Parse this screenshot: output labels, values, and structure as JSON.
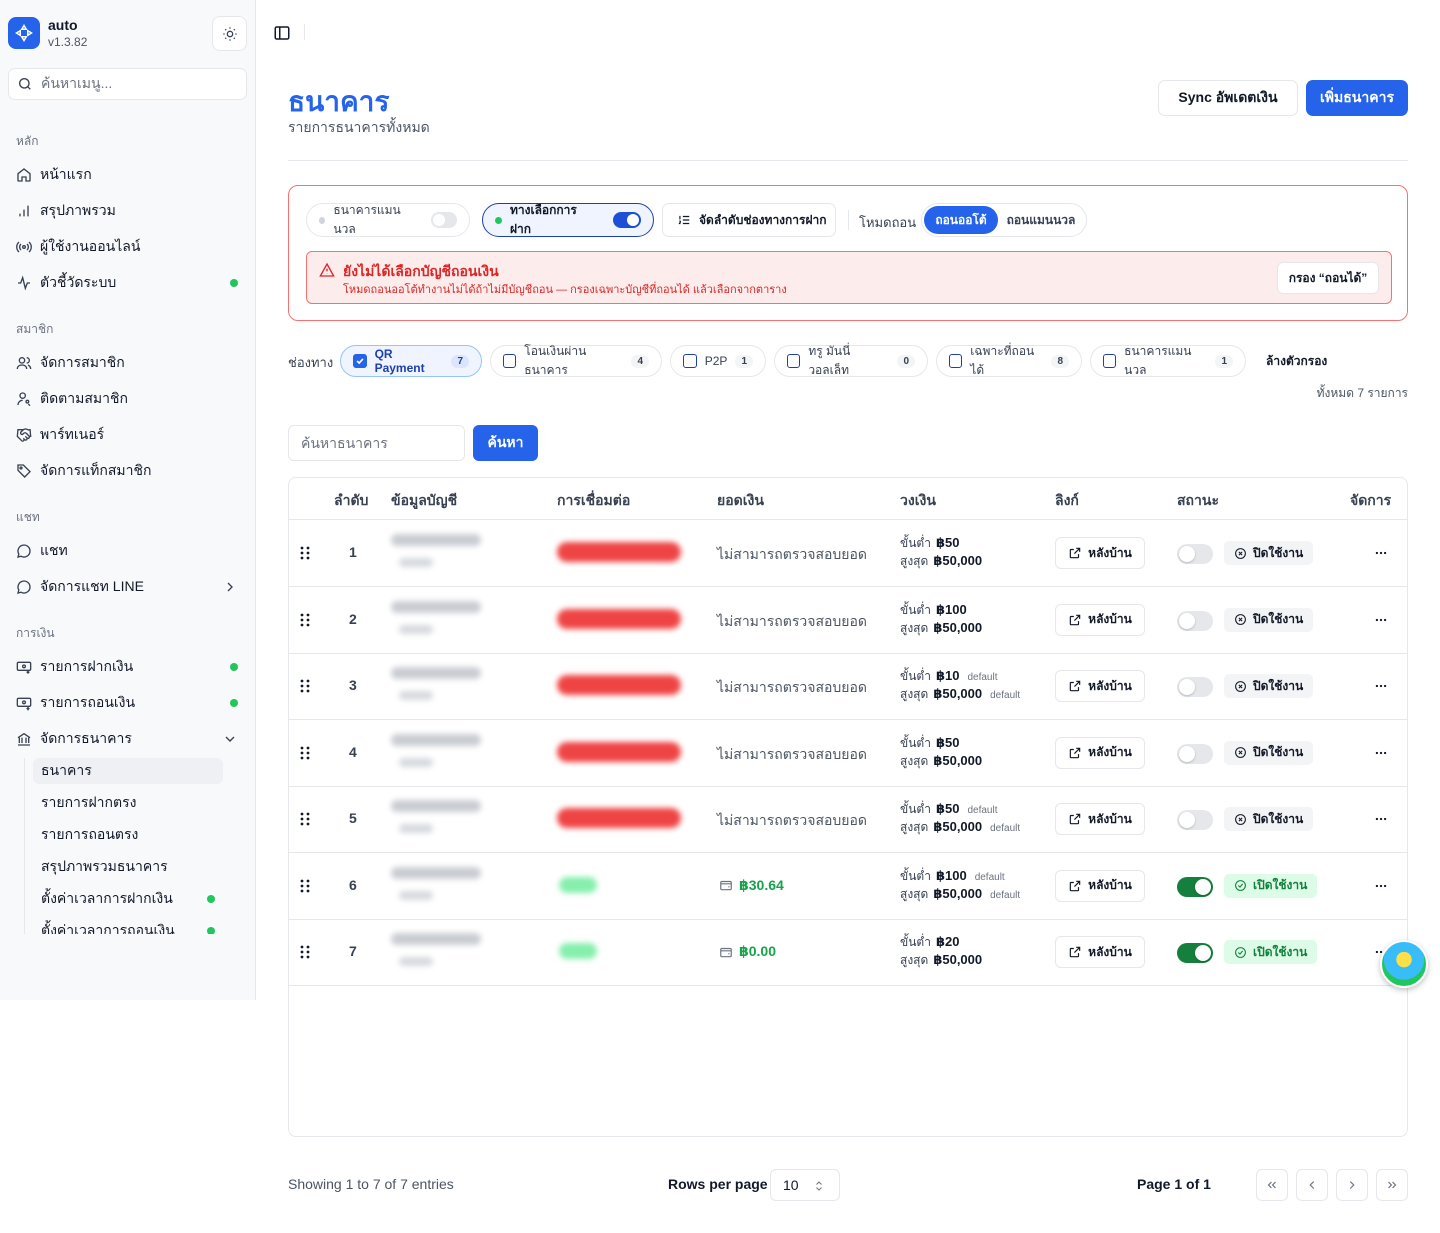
{
  "app": {
    "name": "auto",
    "version": "v1.3.82"
  },
  "sidebar": {
    "search_placeholder": "ค้นหาเมนู...",
    "groups": {
      "main": "หลัก",
      "members": "สมาชิก",
      "chat": "แชท",
      "finance": "การเงิน"
    },
    "items": {
      "home": "หน้าแรก",
      "summary": "สรุปภาพรวม",
      "online_users": "ผู้ใช้งานออนไลน์",
      "system_metrics": "ตัวชี้วัดระบบ",
      "manage_members": "จัดการสมาชิก",
      "track_members": "ติดตามสมาชิก",
      "partners": "พาร์ทเนอร์",
      "member_tags": "จัดการแท็กสมาชิก",
      "chat": "แชท",
      "line_chat": "จัดการแชท LINE",
      "deposits": "รายการฝากเงิน",
      "withdrawals": "รายการถอนเงิน",
      "manage_banks": "จัดการธนาคาร"
    },
    "sub_items": {
      "banks": "ธนาคาร",
      "direct_deposits": "รายการฝากตรง",
      "direct_withdrawals": "รายการถอนตรง",
      "bank_summary": "สรุปภาพรวมธนาคาร",
      "deposit_time": "ตั้งค่าเวลาการฝากเงิน",
      "withdraw_time": "ตั้งค่าเวลาการถอนเงิน"
    }
  },
  "header": {
    "title": "ธนาคาร",
    "subtitle": "รายการธนาคารทั้งหมด",
    "sync_button": "Sync อัพเดตเงิน",
    "add_button": "เพิ่มธนาคาร"
  },
  "deposit_panel": {
    "manual_bank_toggle": "ธนาคารแมนนวล",
    "deposit_channel_toggle": "ทางเลือกการฝาก",
    "order_button": "จัดลำดับช่องทางการฝาก",
    "mode_label": "โหมดถอน",
    "mode_auto": "ถอนออโต้",
    "mode_manual": "ถอนแมนนวล",
    "alert_title": "ยังไม่ได้เลือกบัญชีถอนเงิน",
    "alert_desc": "โหมดถอนออโต้ทำงานไม่ได้ถ้าไม่มีบัญชีถอน — กรองเฉพาะบัญชีที่ถอนได้ แล้วเลือกจากตาราง",
    "alert_button": "กรอง “ถอนได้”"
  },
  "filters": {
    "label": "ช่องทาง",
    "chips": [
      {
        "label": "QR Payment",
        "count": "7"
      },
      {
        "label": "โอนเงินผ่านธนาคาร",
        "count": "4"
      },
      {
        "label": "P2P",
        "count": "1"
      },
      {
        "label": "ทรู มันนี่ วอลเล็ท",
        "count": "0"
      },
      {
        "label": "เฉพาะที่ถอนได้",
        "count": "8"
      },
      {
        "label": "ธนาคารแมนนวล",
        "count": "1"
      }
    ],
    "clear": "ล้างตัวกรอง",
    "total": "ทั้งหมด 7 รายการ"
  },
  "search": {
    "placeholder": "ค้นหาธนาคาร",
    "button": "ค้นหา"
  },
  "table": {
    "columns": {
      "index": "ลำดับ",
      "account": "ข้อมูลบัญชี",
      "connection": "การเชื่อมต่อ",
      "balance": "ยอดเงิน",
      "limit": "วงเงิน",
      "link": "ลิงก์",
      "status": "สถานะ",
      "actions": "จัดการ"
    },
    "labels": {
      "min": "ขั้นต่ำ",
      "max": "สูงสุด",
      "default": "default",
      "link_button": "หลังบ้าน"
    },
    "rows": [
      {
        "index": "1",
        "balance": "ไม่สามารถตรวจสอบยอด",
        "min": "฿50",
        "max": "฿50,000",
        "min_default": false,
        "max_default": false,
        "status": "ปิดใช้งาน",
        "enabled": false
      },
      {
        "index": "2",
        "balance": "ไม่สามารถตรวจสอบยอด",
        "min": "฿100",
        "max": "฿50,000",
        "min_default": false,
        "max_default": false,
        "status": "ปิดใช้งาน",
        "enabled": false
      },
      {
        "index": "3",
        "balance": "ไม่สามารถตรวจสอบยอด",
        "min": "฿10",
        "max": "฿50,000",
        "min_default": true,
        "max_default": true,
        "status": "ปิดใช้งาน",
        "enabled": false
      },
      {
        "index": "4",
        "balance": "ไม่สามารถตรวจสอบยอด",
        "min": "฿50",
        "max": "฿50,000",
        "min_default": false,
        "max_default": false,
        "status": "ปิดใช้งาน",
        "enabled": false
      },
      {
        "index": "5",
        "balance": "ไม่สามารถตรวจสอบยอด",
        "min": "฿50",
        "max": "฿50,000",
        "min_default": true,
        "max_default": true,
        "status": "ปิดใช้งาน",
        "enabled": false
      },
      {
        "index": "6",
        "balance": "฿30.64",
        "min": "฿100",
        "max": "฿50,000",
        "min_default": true,
        "max_default": true,
        "status": "เปิดใช้งาน",
        "enabled": true
      },
      {
        "index": "7",
        "balance": "฿0.00",
        "min": "฿20",
        "max": "฿50,000",
        "min_default": false,
        "max_default": false,
        "status": "เปิดใช้งาน",
        "enabled": true
      }
    ]
  },
  "footer": {
    "showing": "Showing 1 to 7 of 7 entries",
    "rows_per_page_label": "Rows per page",
    "rows_per_page": "10",
    "page_info": "Page 1 of 1"
  }
}
